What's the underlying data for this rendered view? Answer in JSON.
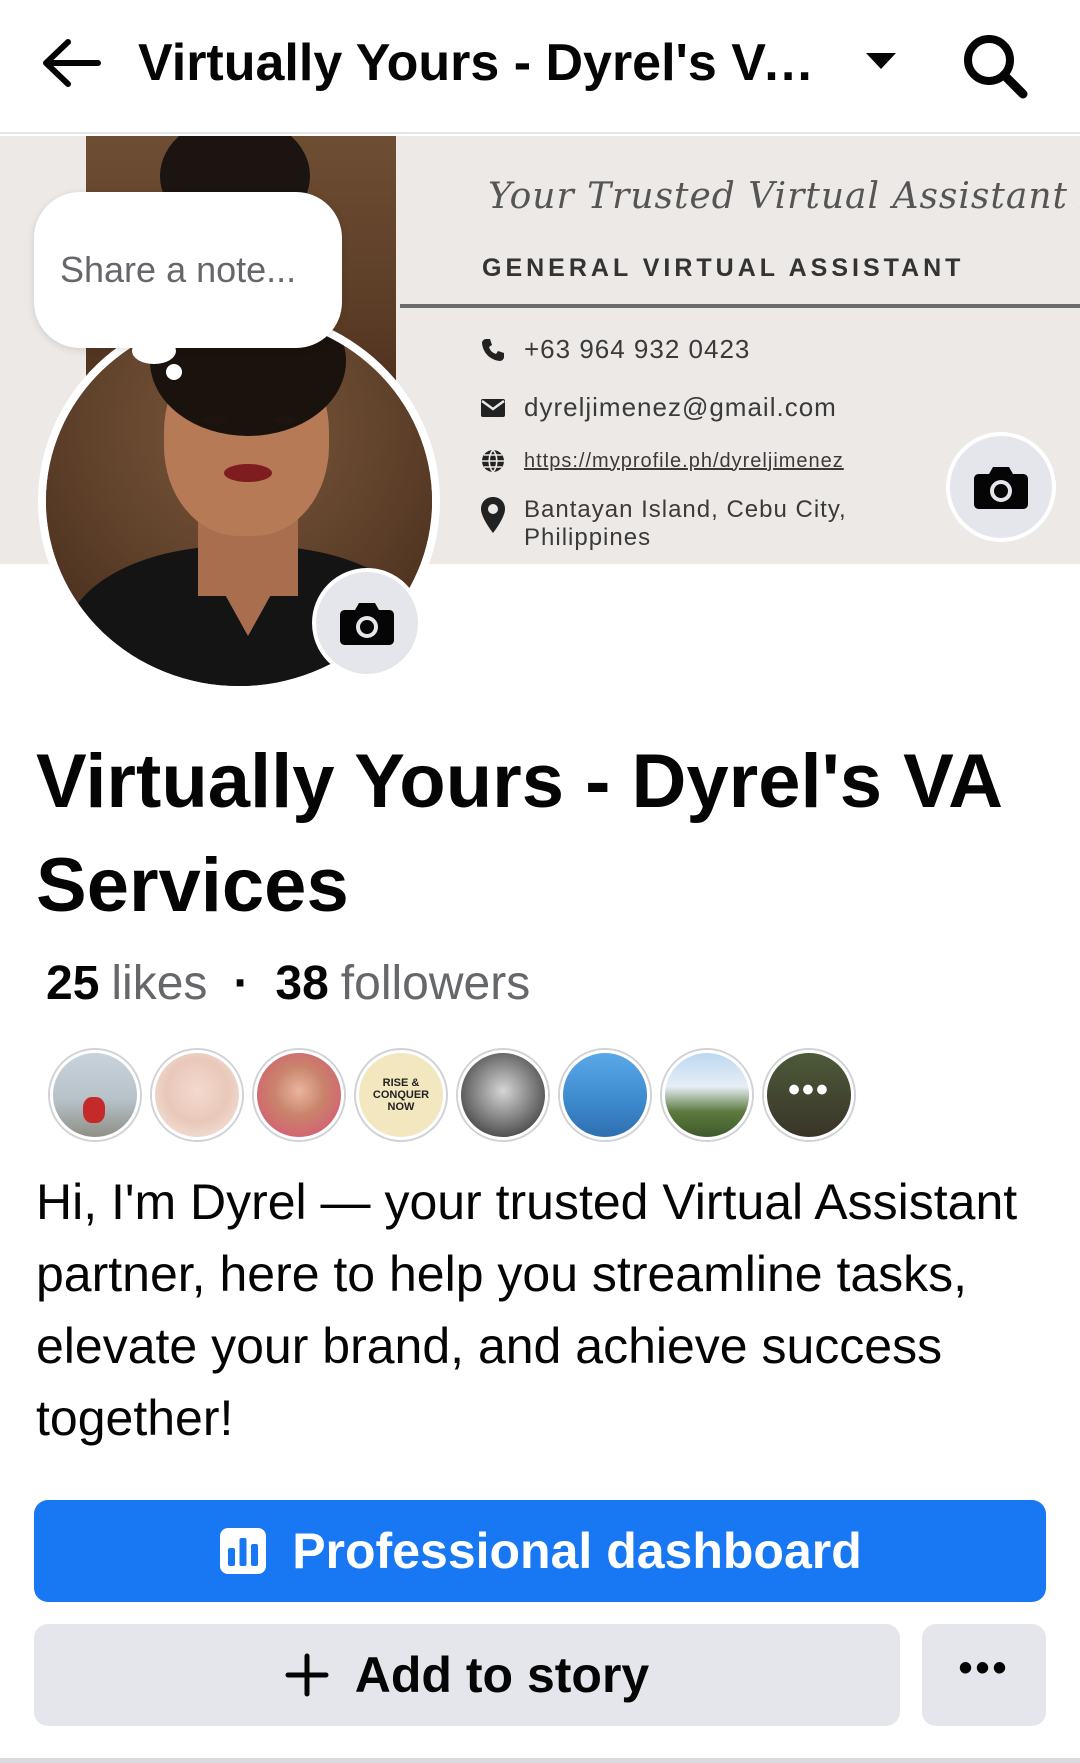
{
  "topbar": {
    "title": "Virtually Yours - Dyrel's VA...",
    "back_icon": "arrow-left-icon",
    "caret_icon": "caret-down-icon",
    "search_icon": "search-icon"
  },
  "cover": {
    "tagline": "Your Trusted Virtual Assistant Partner",
    "role": "GENERAL VIRTUAL ASSISTANT",
    "phone": "+63 964 932 0423",
    "email": "dyreljimenez@gmail.com",
    "website": "https://myprofile.ph/dyreljimenez",
    "location_line1": "Bantayan Island, Cebu City,",
    "location_line2": "Philippines",
    "camera_icon": "camera-icon"
  },
  "note": {
    "placeholder": "Share a note..."
  },
  "page": {
    "name": "Virtually Yours - Dyrel's VA Services",
    "likes_count": "25",
    "likes_label": "likes",
    "separator": "·",
    "followers_count": "38",
    "followers_label": "followers",
    "bio": "Hi, I'm Dyrel — your trusted Virtual Assistant partner, here to help you streamline tasks, elevate your brand, and achieve success together!"
  },
  "followers_strip": {
    "f4_text_line1": "RISE &",
    "f4_text_line2": "CONQUER",
    "f4_text_line3": "NOW",
    "more_label": "•••"
  },
  "actions": {
    "dashboard_label": "Professional dashboard",
    "dashboard_icon": "bar-chart-icon",
    "story_label": "Add to story",
    "story_icon": "plus-icon",
    "more_label": "•••"
  },
  "colors": {
    "accent": "#1877f2",
    "secondary_button": "#e4e6eb",
    "muted_text": "#65676b"
  }
}
